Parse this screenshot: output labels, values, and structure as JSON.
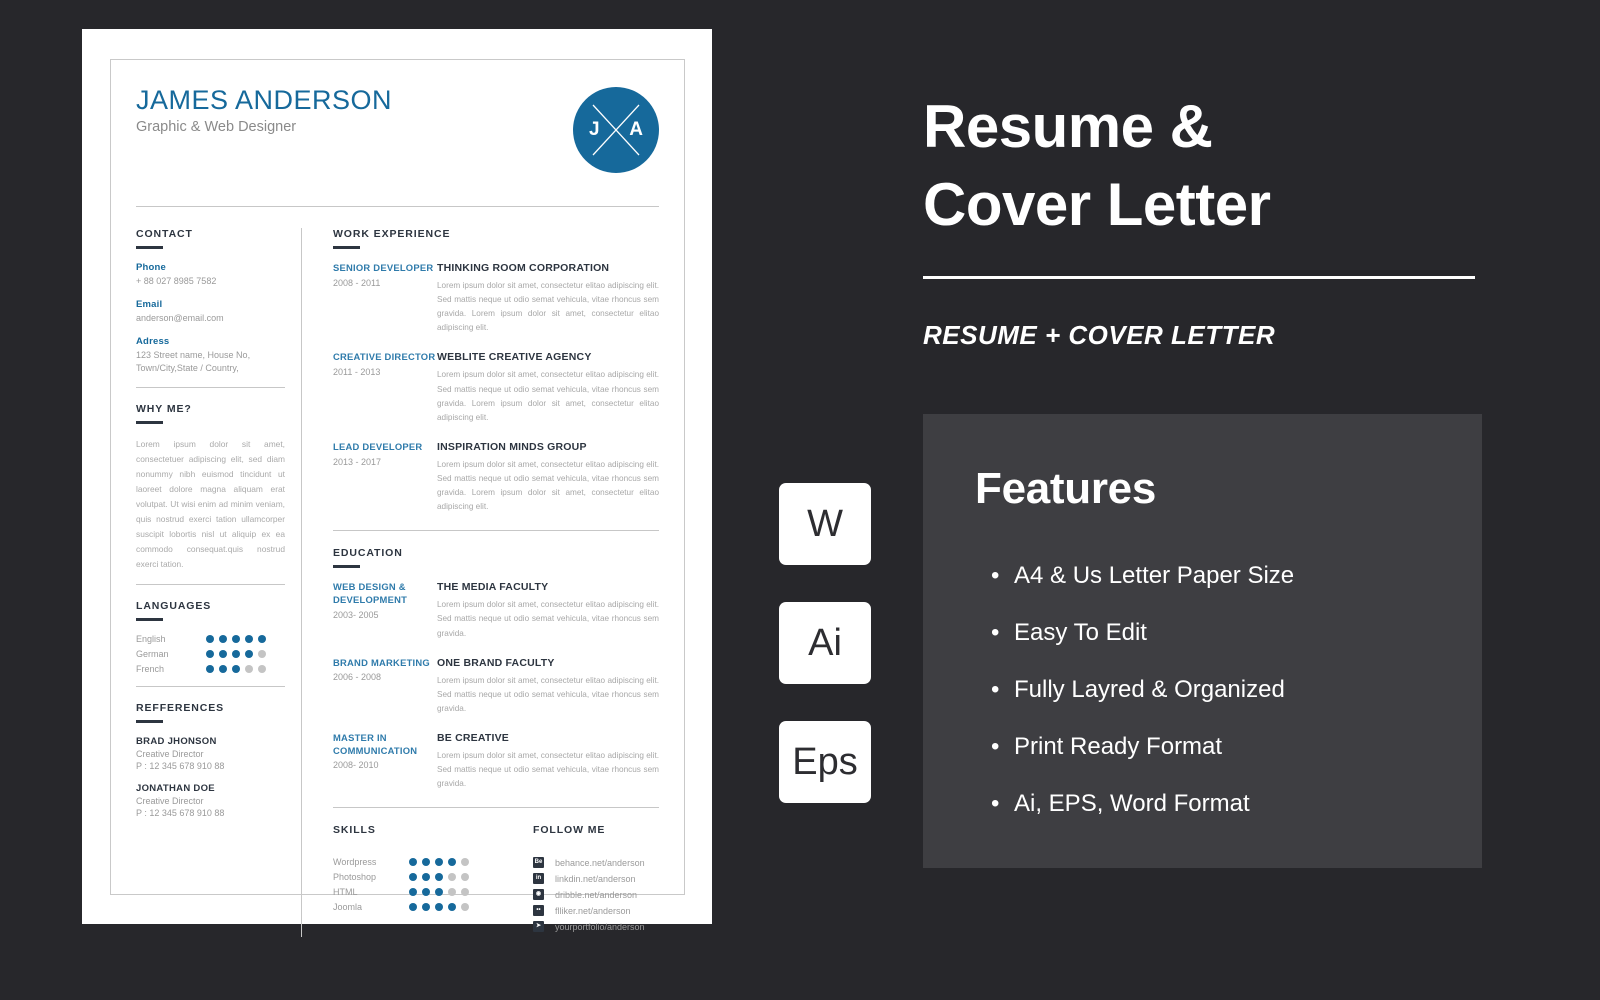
{
  "colors": {
    "background": "#27272b",
    "panel": "#3e3e42",
    "accent_blue": "#16699b",
    "accent_blue_light": "#2f7bab",
    "dark_text": "#2d3540",
    "muted_text": "#9a9a9a",
    "dot_off": "#c4c4c4"
  },
  "resume": {
    "name": "JAMES ANDERSON",
    "role": "Graphic & Web Designer",
    "monogram": {
      "left_letter": "J",
      "right_letter": "A",
      "icon": "x-cross-icon"
    },
    "contact": {
      "heading": "CONTACT",
      "fields": [
        {
          "label": "Phone",
          "value": "+ 88 027 8985 7582"
        },
        {
          "label": "Email",
          "value": "anderson@email.com"
        },
        {
          "label": "Adress",
          "value": "123 Street name, House No,\nTown/City,State / Country,"
        }
      ]
    },
    "why_me": {
      "heading": "WHY ME?",
      "text": "Lorem ipsum dolor sit amet, consectetuer adipiscing elit, sed diam nonummy nibh euismod tincidunt ut laoreet dolore magna aliquam erat volutpat. Ut wisi enim ad minim veniam, quis nostrud exerci tation ullamcorper suscipit lobortis nisl ut aliquip ex ea commodo consequat.quis nostrud exerci tation."
    },
    "languages": {
      "heading": "LANGUAGES",
      "max_dots": 5,
      "items": [
        {
          "name": "English",
          "level": 5
        },
        {
          "name": "German",
          "level": 4
        },
        {
          "name": "French",
          "level": 3
        }
      ]
    },
    "references": {
      "heading": "REFFERENCES",
      "items": [
        {
          "name": "BRAD JHONSON",
          "role": "Creative Director",
          "phone": "P : 12 345 678 910 88"
        },
        {
          "name": "JONATHAN DOE",
          "role": "Creative Director",
          "phone": "P : 12 345 678 910 88"
        }
      ]
    },
    "work_experience": {
      "heading": "WORK EXPERIENCE",
      "items": [
        {
          "title": "SENIOR DEVELOPER",
          "date": "2008 - 2011",
          "org": "THINKING ROOM CORPORATION",
          "desc": "Lorem ipsum dolor sit amet, consectetur elitao adipiscing elit. Sed mattis neque ut odio semat vehicula, vitae rhoncus sem gravida. Lorem ipsum dolor sit amet, consectetur elitao adipiscing elit."
        },
        {
          "title": "CREATIVE DIRECTOR",
          "date": "2011 - 2013",
          "org": "WEBLITE CREATIVE AGENCY",
          "desc": "Lorem ipsum dolor sit amet, consectetur elitao adipiscing elit. Sed mattis neque ut odio semat vehicula, vitae rhoncus sem gravida. Lorem ipsum dolor sit amet, consectetur elitao adipiscing elit."
        },
        {
          "title": "LEAD DEVELOPER",
          "date": "2013 - 2017",
          "org": "INSPIRATION MINDS GROUP",
          "desc": "Lorem ipsum dolor sit amet, consectetur elitao adipiscing elit. Sed mattis neque ut odio semat vehicula, vitae rhoncus sem gravida. Lorem ipsum dolor sit amet, consectetur elitao adipiscing elit."
        }
      ]
    },
    "education": {
      "heading": "EDUCATION",
      "items": [
        {
          "title": "WEB DESIGN & DEVELOPMENT",
          "date": "2003- 2005",
          "org": "THE MEDIA FACULTY",
          "desc": "Lorem ipsum dolor sit amet, consectetur elitao adipiscing elit. Sed mattis neque ut odio semat vehicula, vitae rhoncus sem gravida."
        },
        {
          "title": "BRAND MARKETING",
          "date": "2006 - 2008",
          "org": "ONE BRAND FACULTY",
          "desc": "Lorem ipsum dolor sit amet, consectetur elitao adipiscing elit. Sed mattis neque ut odio semat vehicula, vitae rhoncus sem gravida."
        },
        {
          "title": "MASTER IN COMMUNICATION",
          "date": "2008- 2010",
          "org": "BE CREATIVE",
          "desc": "Lorem ipsum dolor sit amet, consectetur elitao adipiscing elit. Sed mattis neque ut odio semat vehicula, vitae rhoncus sem gravida."
        }
      ]
    },
    "skills": {
      "heading": "SKILLS",
      "max_dots": 5,
      "items": [
        {
          "name": "Wordpress",
          "level": 4
        },
        {
          "name": "Photoshop",
          "level": 3
        },
        {
          "name": "HTML",
          "level": 3
        },
        {
          "name": "Joomla",
          "level": 4
        }
      ]
    },
    "follow_me": {
      "heading": "FOLLOW ME",
      "items": [
        {
          "icon": "behance-icon",
          "glyph": "Be",
          "text": "behance.net/anderson"
        },
        {
          "icon": "linkedin-icon",
          "glyph": "in",
          "text": "linkdin.net/anderson"
        },
        {
          "icon": "dribbble-icon",
          "glyph": "◉",
          "text": "dribble.net/anderson"
        },
        {
          "icon": "flickr-icon",
          "glyph": "••",
          "text": "flliker.net/anderson"
        },
        {
          "icon": "send-icon",
          "glyph": "➤",
          "text": "yourportfolio/anderson"
        }
      ]
    }
  },
  "promo": {
    "title_line1": "Resume &",
    "title_line2": "Cover  Letter",
    "subtitle": "RESUME + COVER LETTER",
    "badges": [
      {
        "name": "word-format-badge",
        "label": "W"
      },
      {
        "name": "illustrator-format-badge",
        "label": "Ai"
      },
      {
        "name": "eps-format-badge",
        "label": "Eps"
      }
    ],
    "features": {
      "title": "Features",
      "bullet": "•",
      "items": [
        "A4  & Us Letter Paper Size",
        "Easy To Edit",
        "Fully Layred & Organized",
        "Print Ready Format",
        "Ai, EPS, Word Format"
      ]
    }
  }
}
